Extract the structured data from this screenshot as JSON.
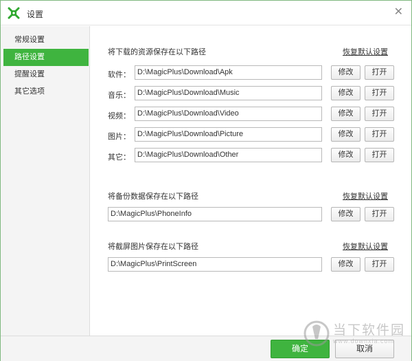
{
  "window": {
    "title": "设置",
    "colors": {
      "accent": "#3fb43f",
      "logo": "#2fa82f"
    }
  },
  "sidebar": {
    "items": [
      {
        "label": "常规设置",
        "active": false
      },
      {
        "label": "路径设置",
        "active": true
      },
      {
        "label": "提醒设置",
        "active": false
      },
      {
        "label": "其它选项",
        "active": false
      }
    ]
  },
  "downloads": {
    "heading": "将下载的资源保存在以下路径",
    "restore": "恢复默认设置",
    "rows": [
      {
        "label": "软件：",
        "path": "D:\\MagicPlus\\Download\\Apk"
      },
      {
        "label": "音乐：",
        "path": "D:\\MagicPlus\\Download\\Music"
      },
      {
        "label": "视频：",
        "path": "D:\\MagicPlus\\Download\\Video"
      },
      {
        "label": "图片：",
        "path": "D:\\MagicPlus\\Download\\Picture"
      },
      {
        "label": "其它：",
        "path": "D:\\MagicPlus\\Download\\Other"
      }
    ]
  },
  "backup": {
    "heading": "将备份数据保存在以下路径",
    "restore": "恢复默认设置",
    "path": "D:\\MagicPlus\\PhoneInfo"
  },
  "screenshot": {
    "heading": "将截屏图片保存在以下路径",
    "restore": "恢复默认设置",
    "path": "D:\\MagicPlus\\PrintScreen"
  },
  "buttons": {
    "modify": "修改",
    "open": "打开",
    "ok": "确定",
    "cancel": "取消"
  },
  "watermark": {
    "text": "当下软件园",
    "url": "www.downxia.com"
  }
}
